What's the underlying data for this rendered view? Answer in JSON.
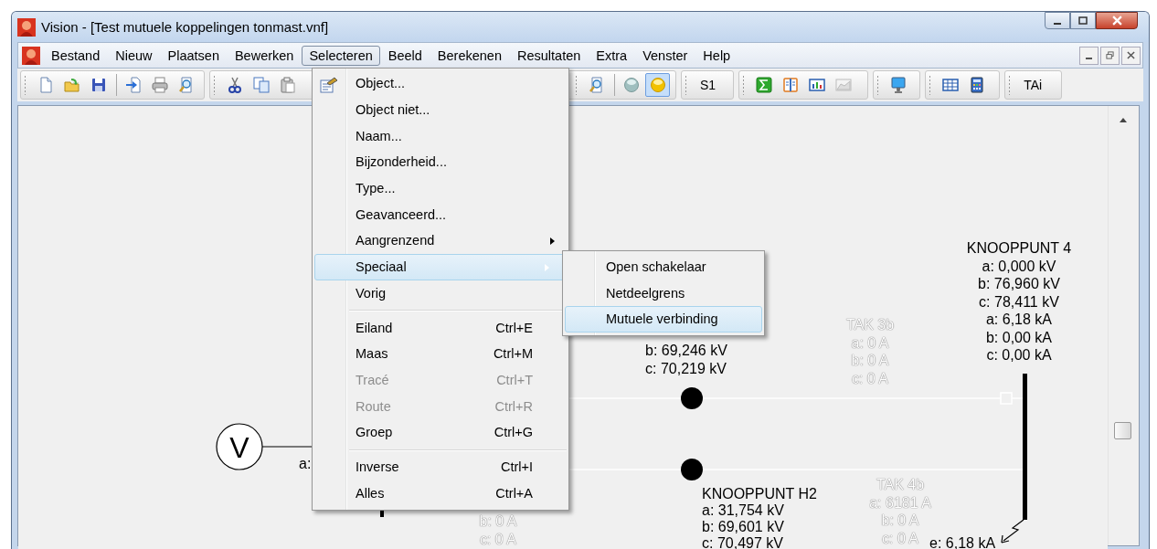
{
  "window": {
    "title": "Vision - [Test mutuele koppelingen tonmast.vnf]"
  },
  "menubar": [
    {
      "label": "Bestand",
      "selected": false
    },
    {
      "label": "Nieuw",
      "selected": false
    },
    {
      "label": "Plaatsen",
      "selected": false
    },
    {
      "label": "Bewerken",
      "selected": false
    },
    {
      "label": "Selecteren",
      "selected": true
    },
    {
      "label": "Beeld",
      "selected": false
    },
    {
      "label": "Berekenen",
      "selected": false
    },
    {
      "label": "Resultaten",
      "selected": false
    },
    {
      "label": "Extra",
      "selected": false
    },
    {
      "label": "Venster",
      "selected": false
    },
    {
      "label": "Help",
      "selected": false
    }
  ],
  "toolbar": [
    {
      "items": [
        {
          "kind": "icon",
          "pressed": false
        },
        {
          "kind": "icon",
          "pressed": false
        },
        {
          "kind": "icon",
          "pressed": false
        },
        {
          "kind": "separator"
        },
        {
          "kind": "icon",
          "pressed": false
        },
        {
          "kind": "icon",
          "pressed": false
        },
        {
          "kind": "icon",
          "pressed": false
        }
      ]
    },
    {
      "items": [
        {
          "kind": "icon",
          "pressed": false
        },
        {
          "kind": "icon",
          "pressed": false
        },
        {
          "kind": "icon",
          "pressed": false
        }
      ]
    },
    {
      "items": [
        {
          "kind": "icon",
          "pressed": false
        },
        {
          "kind": "separator"
        },
        {
          "kind": "icon",
          "pressed": false
        },
        {
          "kind": "icon",
          "pressed": true
        }
      ]
    },
    {
      "items": [
        {
          "kind": "text",
          "label": "S1",
          "pressed": false
        }
      ]
    },
    {
      "items": [
        {
          "kind": "icon",
          "pressed": false
        },
        {
          "kind": "icon",
          "pressed": false
        },
        {
          "kind": "icon",
          "pressed": false
        },
        {
          "kind": "icon",
          "pressed": false
        }
      ]
    },
    {
      "items": [
        {
          "kind": "icon",
          "pressed": false
        }
      ]
    },
    {
      "items": [
        {
          "kind": "icon",
          "pressed": false
        },
        {
          "kind": "icon",
          "pressed": false
        }
      ]
    },
    {
      "items": [
        {
          "kind": "text",
          "label": "TAi",
          "pressed": false
        }
      ]
    }
  ],
  "dropdown": {
    "items": [
      {
        "kind": "item",
        "label": "Object...",
        "disabled": false,
        "highlighted": false,
        "has_submenu": false
      },
      {
        "kind": "item",
        "label": "Object niet...",
        "disabled": false,
        "highlighted": false,
        "has_submenu": false
      },
      {
        "kind": "item",
        "label": "Naam...",
        "disabled": false,
        "highlighted": false,
        "has_submenu": false
      },
      {
        "kind": "item",
        "label": "Bijzonderheid...",
        "disabled": false,
        "highlighted": false,
        "has_submenu": false
      },
      {
        "kind": "item",
        "label": "Type...",
        "disabled": false,
        "highlighted": false,
        "has_submenu": false
      },
      {
        "kind": "item",
        "label": "Geavanceerd...",
        "disabled": false,
        "highlighted": false,
        "has_submenu": false
      },
      {
        "kind": "item",
        "label": "Aangrenzend",
        "disabled": false,
        "highlighted": false,
        "has_submenu": true
      },
      {
        "kind": "item",
        "label": "Speciaal",
        "disabled": false,
        "highlighted": true,
        "has_submenu": true
      },
      {
        "kind": "item",
        "label": "Vorig",
        "disabled": false,
        "highlighted": false,
        "has_submenu": false
      },
      {
        "kind": "separator"
      },
      {
        "kind": "item",
        "label": "Eiland",
        "shortcut": "Ctrl+E",
        "disabled": false,
        "highlighted": false,
        "has_submenu": false
      },
      {
        "kind": "item",
        "label": "Maas",
        "shortcut": "Ctrl+M",
        "disabled": false,
        "highlighted": false,
        "has_submenu": false
      },
      {
        "kind": "item",
        "label": "Tracé",
        "shortcut": "Ctrl+T",
        "disabled": true,
        "highlighted": false,
        "has_submenu": false
      },
      {
        "kind": "item",
        "label": "Route",
        "shortcut": "Ctrl+R",
        "disabled": true,
        "highlighted": false,
        "has_submenu": false
      },
      {
        "kind": "item",
        "label": "Groep",
        "shortcut": "Ctrl+G",
        "disabled": false,
        "highlighted": false,
        "has_submenu": false
      },
      {
        "kind": "separator"
      },
      {
        "kind": "item",
        "label": "Inverse",
        "shortcut": "Ctrl+I",
        "disabled": false,
        "highlighted": false,
        "has_submenu": false
      },
      {
        "kind": "item",
        "label": "Alles",
        "shortcut": "Ctrl+A",
        "disabled": false,
        "highlighted": false,
        "has_submenu": false
      }
    ]
  },
  "submenu": {
    "items": [
      {
        "label": "Open schakelaar",
        "highlighted": false
      },
      {
        "label": "Netdeelgrens",
        "highlighted": false
      },
      {
        "label": "Mutuele verbinding",
        "highlighted": true
      }
    ]
  },
  "diagram": {
    "source": {
      "label": "V"
    },
    "labels": [
      {
        "kind": "node",
        "lines": [
          "KNOOPPUNT 4",
          "a: 0,000 kV",
          "b: 76,960 kV",
          "c: 78,411 kV",
          "a: 6,18 kA",
          "b: 0,00 kA",
          "c: 0,00 kA"
        ]
      },
      {
        "kind": "branch",
        "lines": [
          "TAK 3b",
          "a: 0 A",
          "b: 0 A",
          "c: 0 A"
        ]
      },
      {
        "kind": "node",
        "lines": [
          "b: 69,246 kV",
          "c: 70,219 kV"
        ]
      },
      {
        "kind": "node",
        "lines": [
          "a:"
        ]
      },
      {
        "kind": "branch",
        "lines": [
          "b: 0 A",
          "c: 0 A"
        ]
      },
      {
        "kind": "node",
        "lines": [
          "KNOOPPUNT H2",
          "a: 31,754 kV",
          "b: 69,601 kV",
          "c: 70,497 kV"
        ]
      },
      {
        "kind": "branch",
        "lines": [
          "TAK 4b",
          "a: 6181 A",
          "b: 0 A",
          "c: 0 A"
        ]
      },
      {
        "kind": "node",
        "lines": [
          "e: 6,18 kA"
        ]
      }
    ]
  }
}
